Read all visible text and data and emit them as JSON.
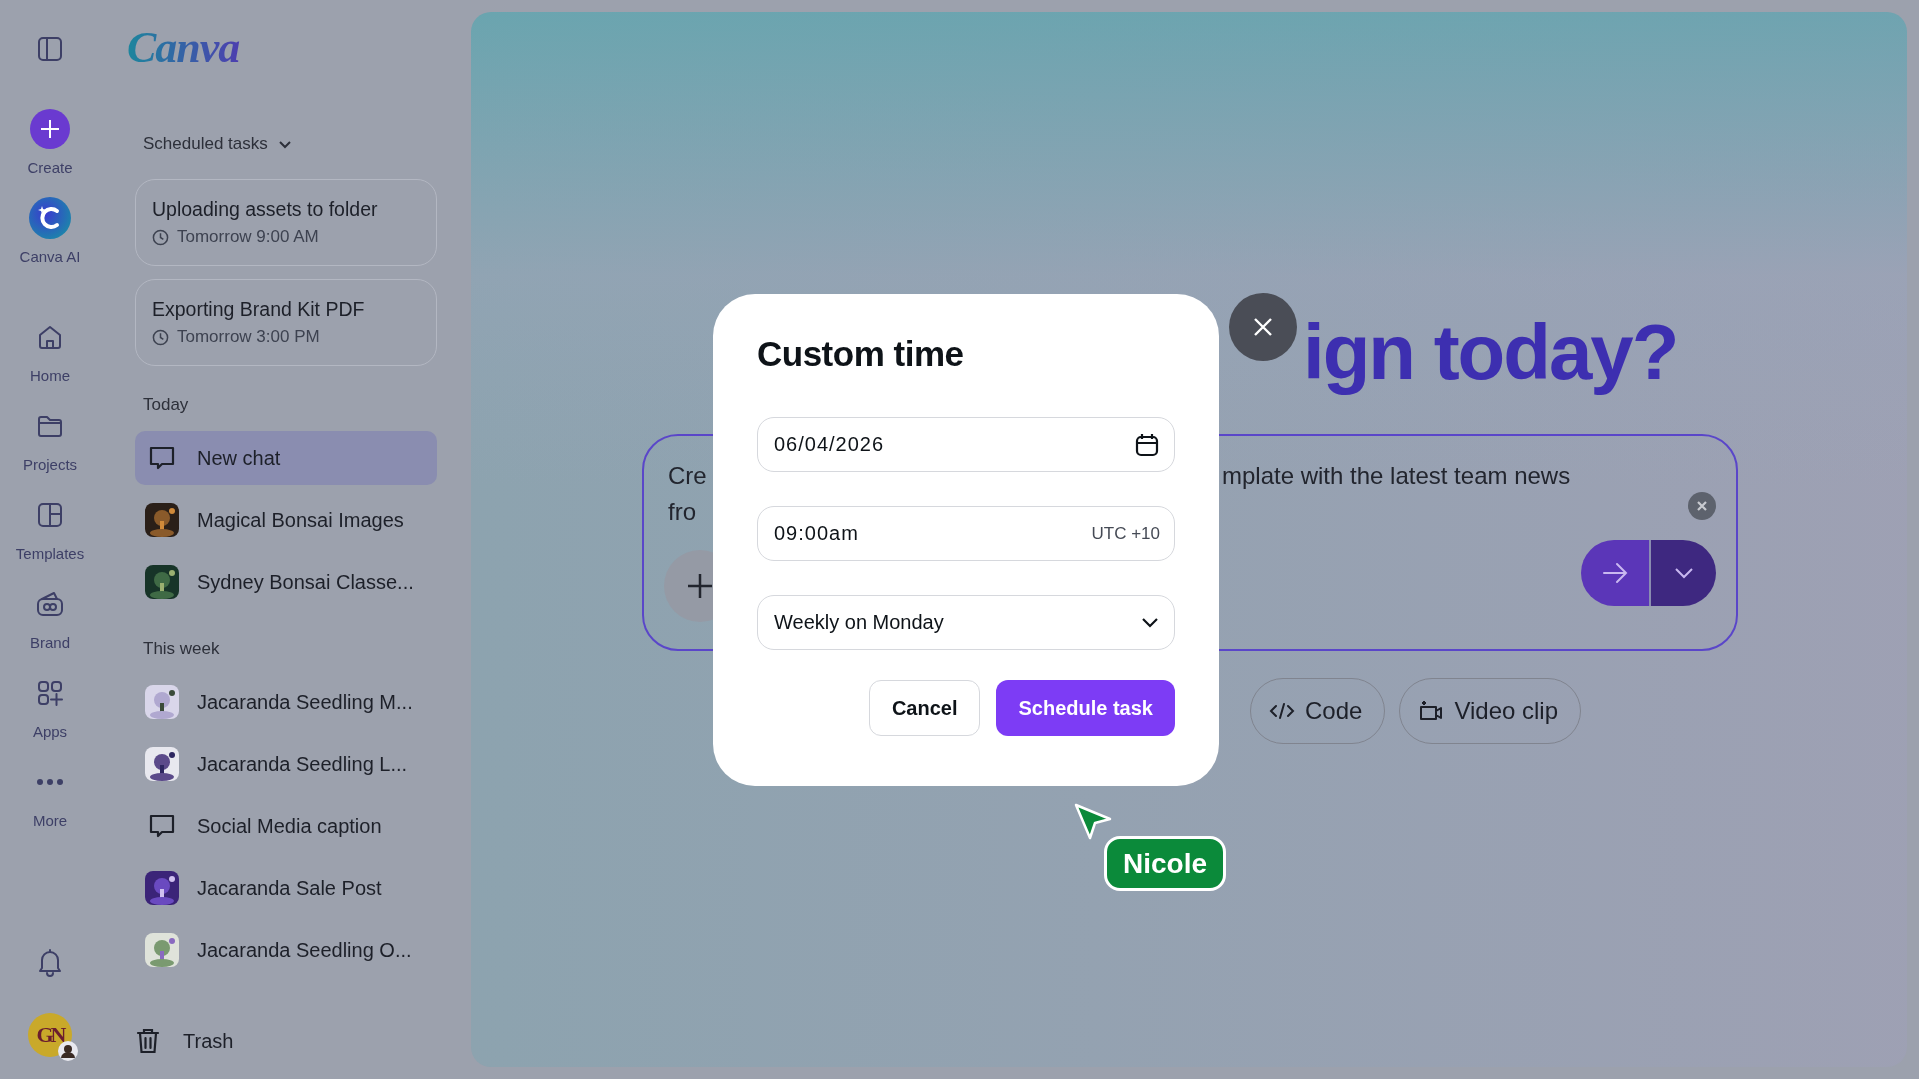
{
  "nav": {
    "items": [
      {
        "label": "Create",
        "kind": "create"
      },
      {
        "label": "Canva AI",
        "kind": "ai"
      },
      {
        "label": "Home",
        "kind": "home"
      },
      {
        "label": "Projects",
        "kind": "projects"
      },
      {
        "label": "Templates",
        "kind": "templates"
      },
      {
        "label": "Brand",
        "kind": "brand"
      },
      {
        "label": "Apps",
        "kind": "apps"
      },
      {
        "label": "More",
        "kind": "more"
      }
    ],
    "avatar": "GN"
  },
  "sidebar": {
    "logo": "Canva",
    "scheduled_label": "Scheduled tasks",
    "tasks": [
      {
        "title": "Uploading assets to folder",
        "time": "Tomorrow 9:00 AM"
      },
      {
        "title": "Exporting Brand Kit PDF",
        "time": "Tomorrow 3:00 PM"
      }
    ],
    "sections": [
      {
        "title": "Today",
        "items": [
          {
            "label": "New chat",
            "kind": "chat",
            "selected": true
          },
          {
            "label": "Magical Bonsai Images",
            "kind": "picture",
            "selected": false
          },
          {
            "label": "Sydney Bonsai Classe...",
            "kind": "picture",
            "selected": false
          }
        ]
      },
      {
        "title": "This week",
        "items": [
          {
            "label": "Jacaranda Seedling M...",
            "kind": "picture",
            "selected": false
          },
          {
            "label": "Jacaranda Seedling L...",
            "kind": "picture",
            "selected": false
          },
          {
            "label": "Social Media caption",
            "kind": "chat",
            "selected": false
          },
          {
            "label": "Jacaranda Sale Post",
            "kind": "picture",
            "selected": false
          },
          {
            "label": "Jacaranda Seedling O...",
            "kind": "picture",
            "selected": false
          }
        ]
      }
    ],
    "trash": "Trash"
  },
  "main": {
    "heading": "ign today?",
    "prompt": {
      "left_lines": [
        "Cre",
        "fro"
      ],
      "right_text": "mplate with the latest team news"
    },
    "chips": [
      {
        "label": "Code",
        "kind": "code"
      },
      {
        "label": "Video clip",
        "kind": "video"
      }
    ]
  },
  "dialog": {
    "title": "Custom time",
    "date": "06/04/2026",
    "time": "09:00am",
    "timezone": "UTC +10",
    "repeat": "Weekly on Monday",
    "buttons": [
      {
        "label": "Cancel",
        "kind": "secondary"
      },
      {
        "label": "Schedule task",
        "kind": "primary"
      }
    ]
  },
  "collaborator": {
    "name": "Nicole"
  }
}
